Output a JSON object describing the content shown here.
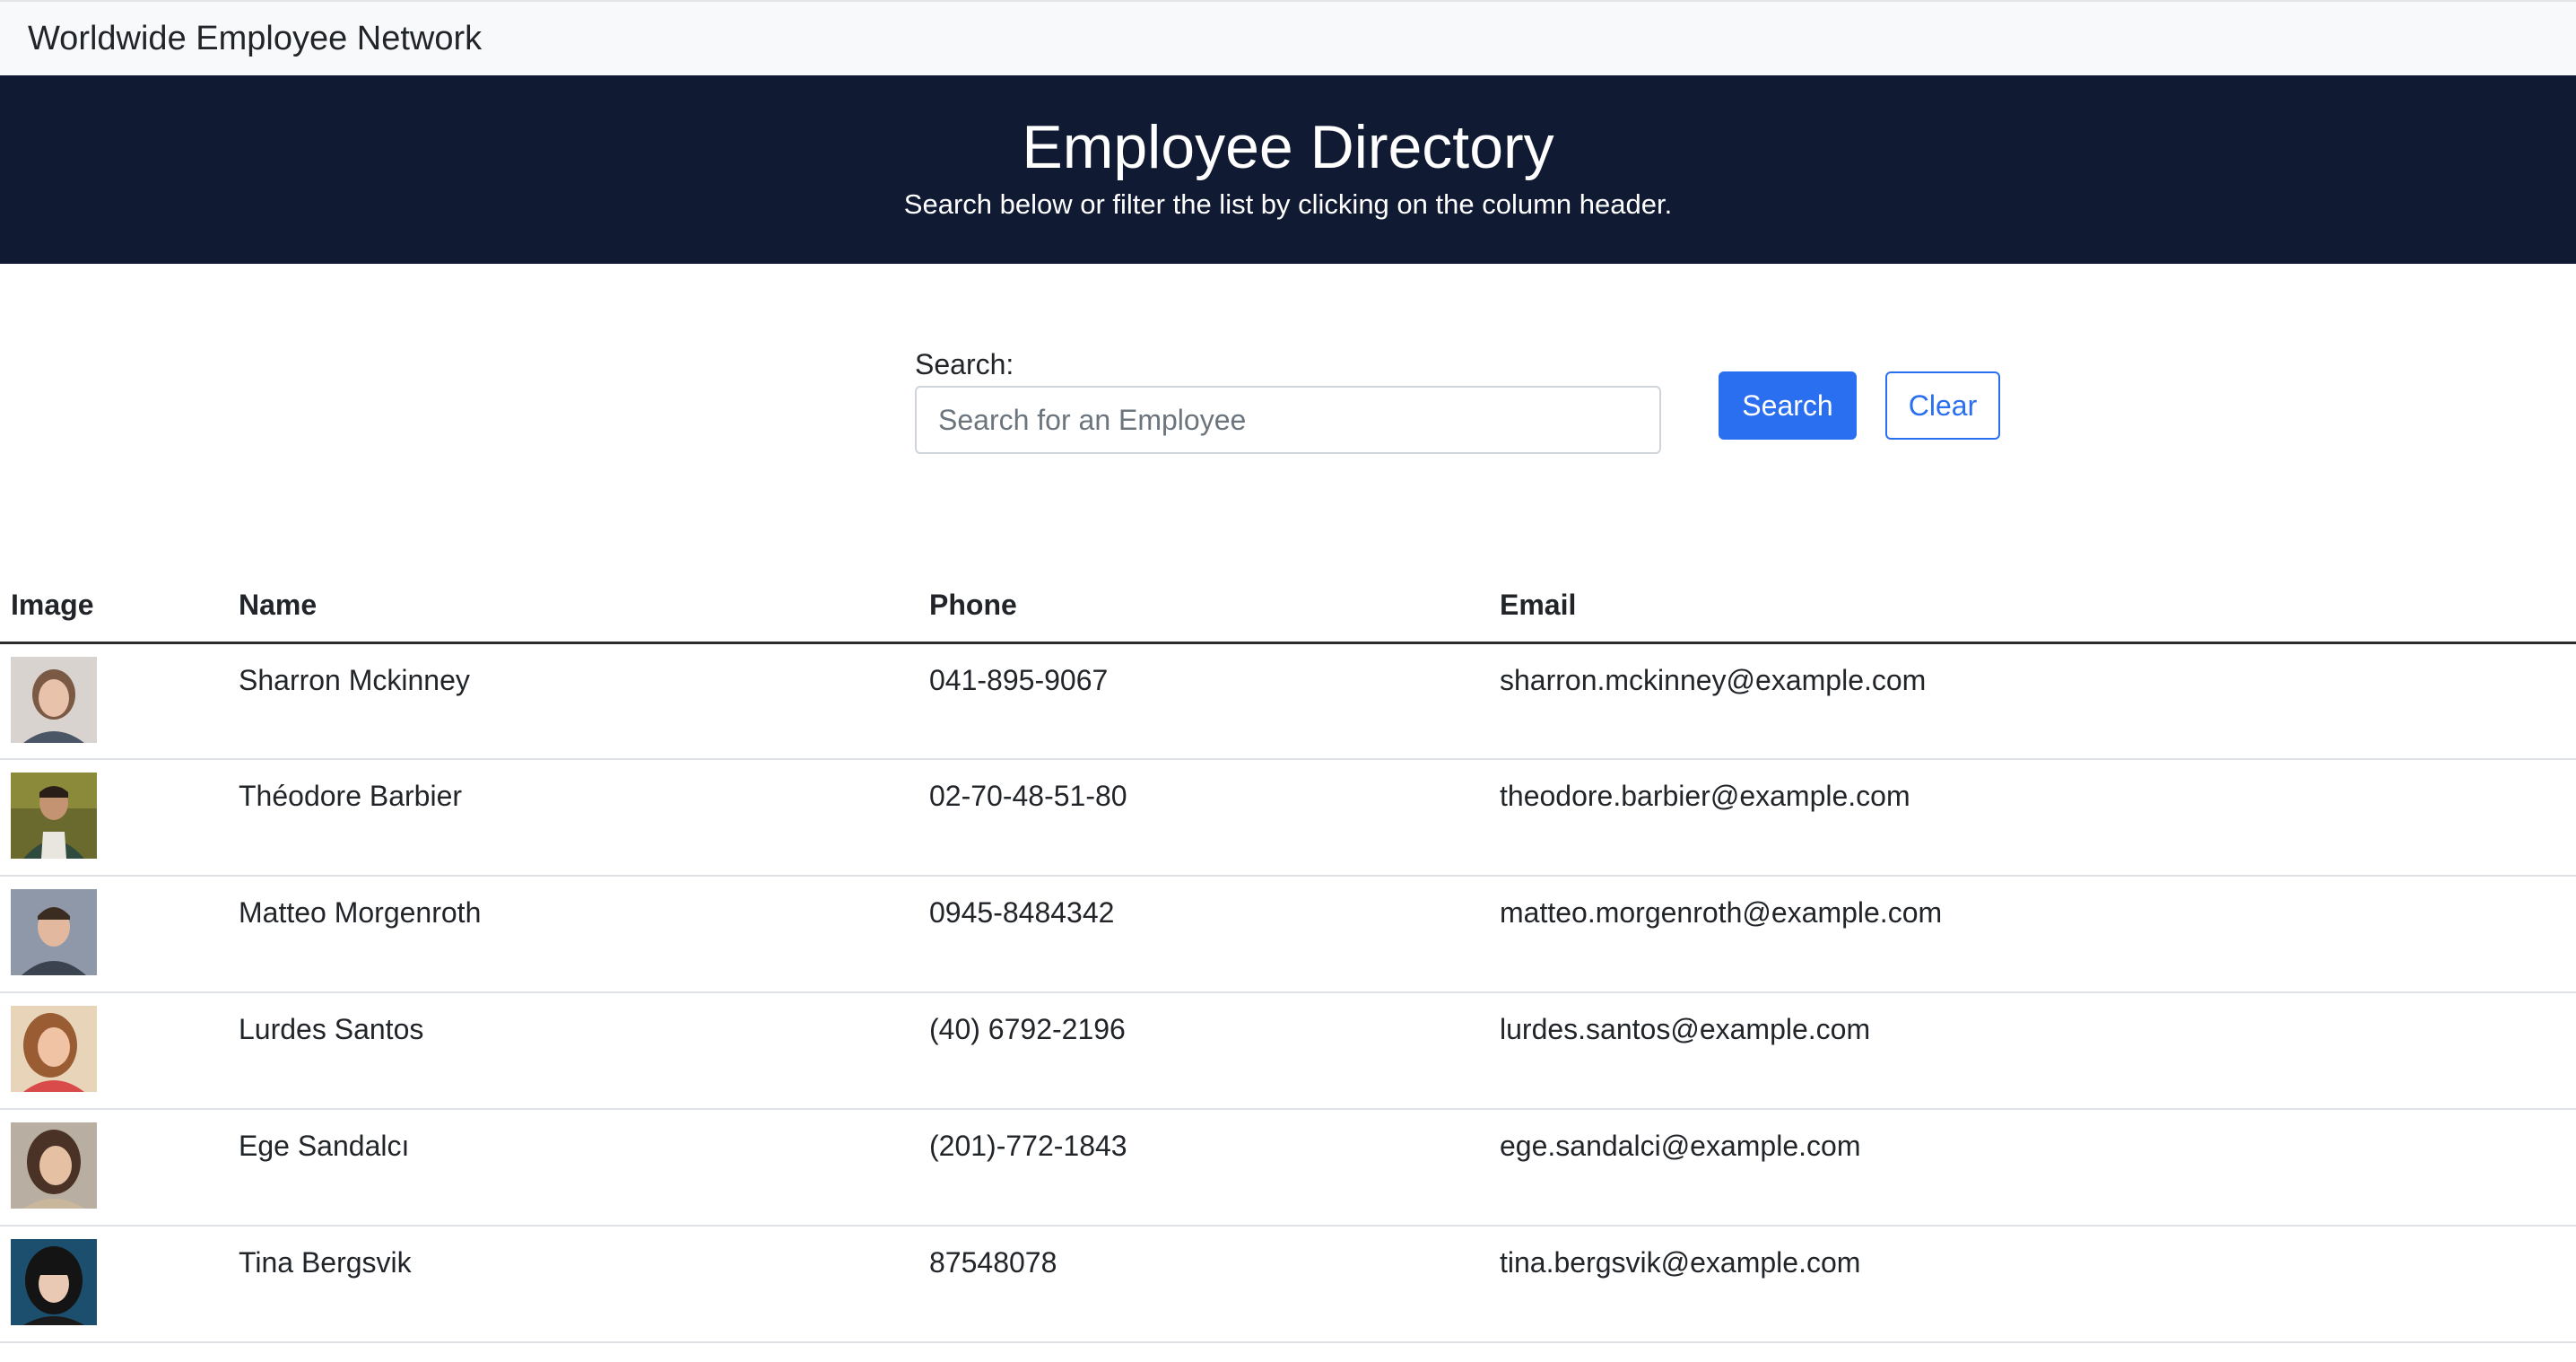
{
  "navbar": {
    "brand": "Worldwide Employee Network"
  },
  "hero": {
    "title": "Employee Directory",
    "subtitle": "Search below or filter the list by clicking on the column header."
  },
  "search": {
    "label": "Search:",
    "placeholder": "Search for an Employee",
    "value": "",
    "search_button": "Search",
    "clear_button": "Clear"
  },
  "table": {
    "headers": {
      "image": "Image",
      "name": "Name",
      "phone": "Phone",
      "email": "Email"
    },
    "rows": [
      {
        "name": "Sharron Mckinney",
        "phone": "041-895-9067",
        "email": "sharron.mckinney@example.com"
      },
      {
        "name": "Théodore Barbier",
        "phone": "02-70-48-51-80",
        "email": "theodore.barbier@example.com"
      },
      {
        "name": "Matteo Morgenroth",
        "phone": "0945-8484342",
        "email": "matteo.morgenroth@example.com"
      },
      {
        "name": "Lurdes Santos",
        "phone": "(40) 6792-2196",
        "email": "lurdes.santos@example.com"
      },
      {
        "name": "Ege Sandalcı",
        "phone": "(201)-772-1843",
        "email": "ege.sandalci@example.com"
      },
      {
        "name": "Tina Bergsvik",
        "phone": "87548078",
        "email": "tina.bergsvik@example.com"
      }
    ]
  },
  "colors": {
    "hero_bg": "#111a33",
    "primary": "#2a6ff0",
    "navbar_bg": "#f8f9fa"
  }
}
